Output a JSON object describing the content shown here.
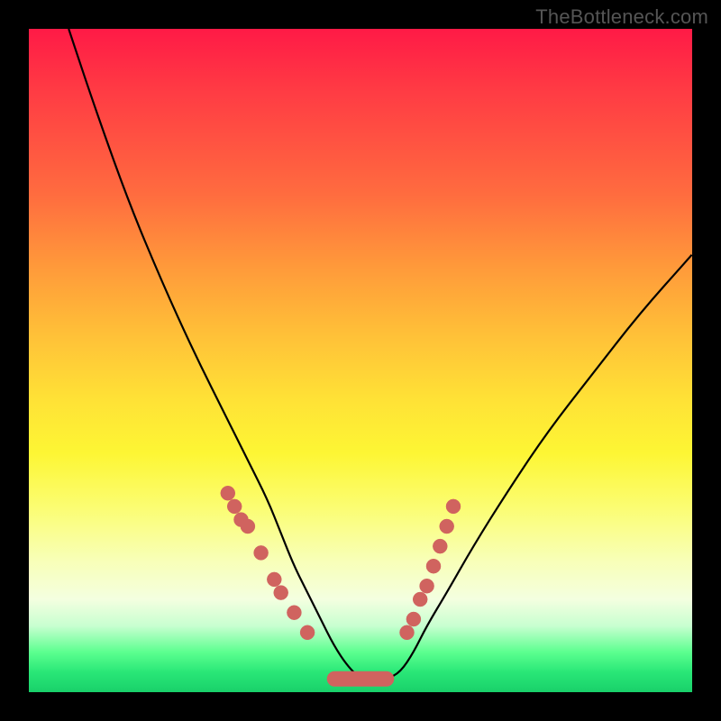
{
  "watermark": "TheBottleneck.com",
  "chart_data": {
    "type": "line",
    "title": "",
    "xlabel": "",
    "ylabel": "",
    "xlim": [
      0,
      100
    ],
    "ylim": [
      0,
      100
    ],
    "series": [
      {
        "name": "curve",
        "x": [
          6,
          10,
          15,
          20,
          25,
          30,
          33,
          36,
          38,
          40,
          42,
          44,
          46,
          48,
          50,
          52,
          54,
          56,
          58,
          60,
          63,
          67,
          72,
          78,
          85,
          92,
          100
        ],
        "values": [
          100,
          88,
          74,
          62,
          51,
          41,
          35,
          29,
          24,
          19,
          15,
          11,
          7,
          4,
          2,
          2,
          2,
          3,
          6,
          10,
          15,
          22,
          30,
          39,
          48,
          57,
          66
        ]
      }
    ],
    "markers": {
      "left_cluster": [
        {
          "x": 30,
          "y": 30
        },
        {
          "x": 31,
          "y": 28
        },
        {
          "x": 32,
          "y": 26
        },
        {
          "x": 33,
          "y": 25
        },
        {
          "x": 35,
          "y": 21
        },
        {
          "x": 37,
          "y": 17
        },
        {
          "x": 38,
          "y": 15
        },
        {
          "x": 40,
          "y": 12
        },
        {
          "x": 42,
          "y": 9
        }
      ],
      "right_cluster": [
        {
          "x": 57,
          "y": 9
        },
        {
          "x": 58,
          "y": 11
        },
        {
          "x": 59,
          "y": 14
        },
        {
          "x": 60,
          "y": 16
        },
        {
          "x": 61,
          "y": 19
        },
        {
          "x": 62,
          "y": 22
        },
        {
          "x": 63,
          "y": 25
        },
        {
          "x": 64,
          "y": 28
        }
      ],
      "bottom_bar": {
        "x_start": 45,
        "x_end": 55,
        "y": 2
      }
    }
  }
}
